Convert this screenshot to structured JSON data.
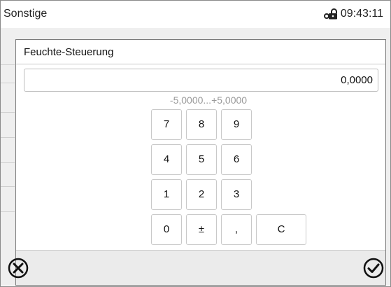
{
  "header": {
    "title": "Sonstige",
    "time": "09:43:11"
  },
  "dialog": {
    "title": "Feuchte-Steuerung",
    "value": "0,0000",
    "range": "-5,0000...+5,0000",
    "keys": [
      "7",
      "8",
      "9",
      "4",
      "5",
      "6",
      "1",
      "2",
      "3",
      "0",
      "±",
      ",",
      "C"
    ]
  },
  "icons": {
    "lock": "lock-icon",
    "cancel": "cancel-circle-icon",
    "confirm": "check-circle-icon"
  }
}
